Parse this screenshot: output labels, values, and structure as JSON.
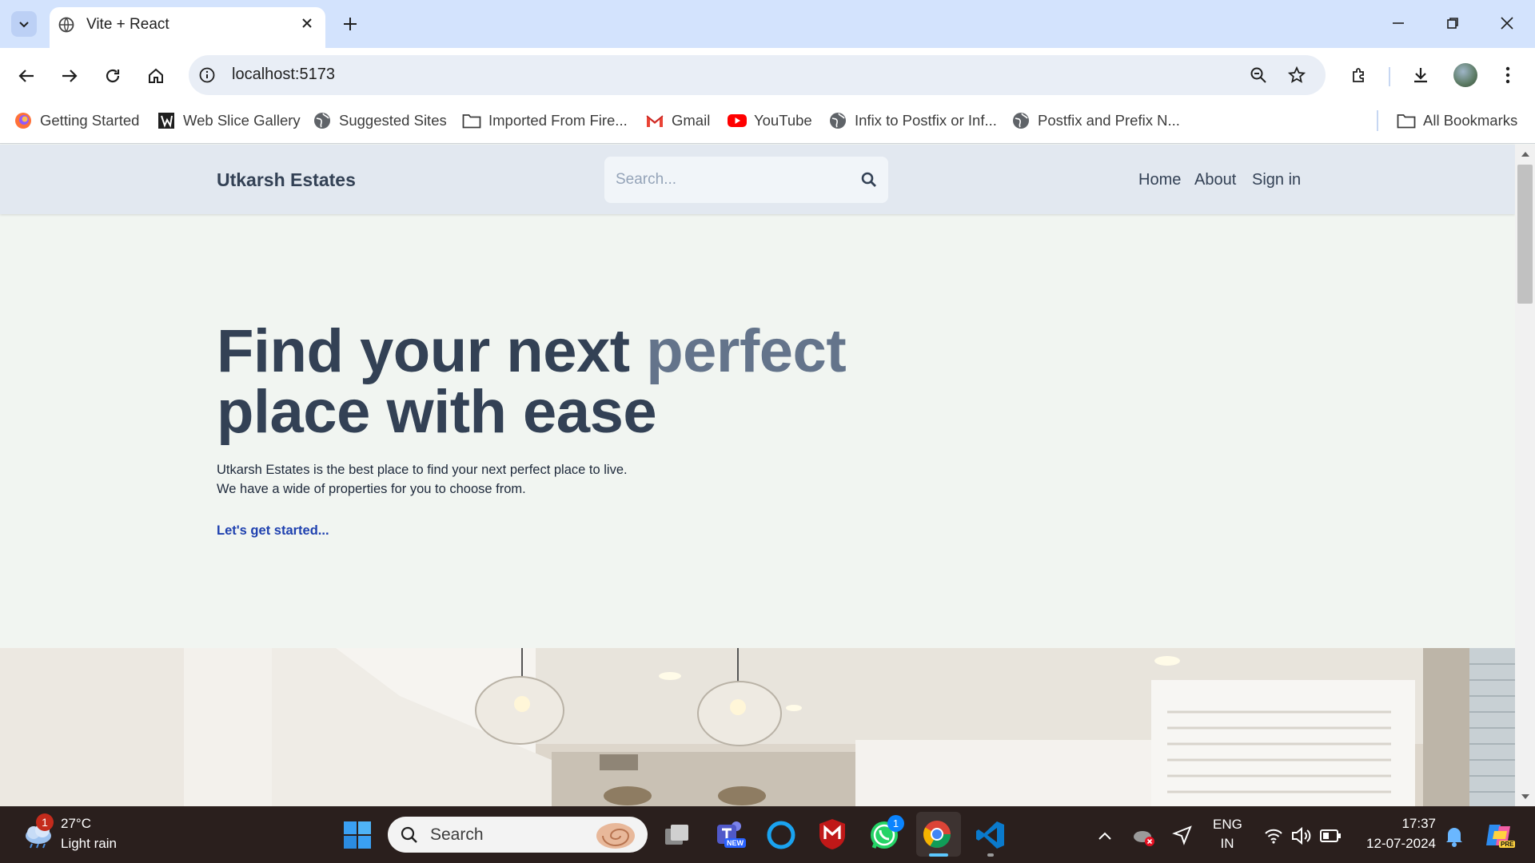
{
  "browser": {
    "tab_title": "Vite + React",
    "url": "localhost:5173",
    "bookmarks": [
      {
        "label": "Getting Started",
        "icon": "firefox-icon"
      },
      {
        "label": "Web Slice Gallery",
        "icon": "web-slice-icon"
      },
      {
        "label": "Suggested Sites",
        "icon": "globe-icon"
      },
      {
        "label": "Imported From Fire...",
        "icon": "folder-icon"
      },
      {
        "label": "Gmail",
        "icon": "gmail-icon"
      },
      {
        "label": "YouTube",
        "icon": "youtube-icon"
      },
      {
        "label": "Infix to Postfix or Inf...",
        "icon": "globe-icon"
      },
      {
        "label": "Postfix and Prefix N...",
        "icon": "globe-icon"
      }
    ],
    "all_bookmarks": "All Bookmarks"
  },
  "site": {
    "logo": "Utkarsh Estates",
    "search_placeholder": "Search...",
    "nav": {
      "home": "Home",
      "about": "About",
      "signin": "Sign in"
    },
    "hero": {
      "line1_part1": "Find your next ",
      "line1_accent": "perfect",
      "line2": "place with ease",
      "sub1": "Utkarsh Estates is the best place to find your next perfect place to live.",
      "sub2": "We have a wide of properties for you to choose from.",
      "cta": "Let's get started..."
    }
  },
  "taskbar": {
    "weather_temp": "27°C",
    "weather_desc": "Light rain",
    "weather_badge": "1",
    "search_label": "Search",
    "whatsapp_badge": "1",
    "lang_line1": "ENG",
    "lang_line2": "IN",
    "time": "17:37",
    "date": "12-07-2024",
    "teams_badge": "NEW",
    "copilot_badge": "PRE"
  },
  "colors": {
    "tabstrip": "#d3e3fd",
    "header_bg": "#e2e8f0",
    "text_dark": "#334155",
    "accent": "#64748b",
    "cta": "#1e40af",
    "taskbar": "#2a1f1d"
  }
}
